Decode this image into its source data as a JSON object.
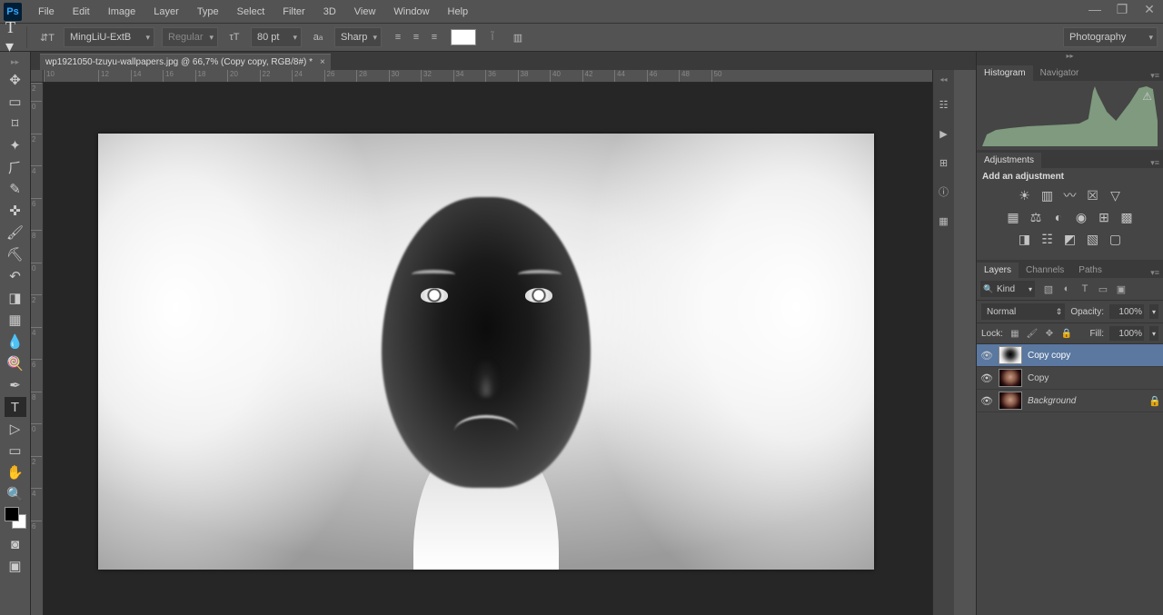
{
  "menu": {
    "items": [
      "File",
      "Edit",
      "Image",
      "Layer",
      "Type",
      "Select",
      "Filter",
      "3D",
      "View",
      "Window",
      "Help"
    ]
  },
  "options": {
    "font": "MingLiU-ExtB",
    "fontStyle": "Regular",
    "size": "80 pt",
    "antialias": "Sharp"
  },
  "workspace": "Photography",
  "document": {
    "tab": "wp1921050-tzuyu-wallpapers.jpg @ 66,7% (Copy copy, RGB/8#) *"
  },
  "ruler_h": [
    "10",
    "12",
    "14",
    "16",
    "18",
    "20",
    "22",
    "24",
    "26",
    "28",
    "30",
    "32",
    "34",
    "36",
    "38",
    "40",
    "42",
    "44",
    "46",
    "48",
    "50"
  ],
  "ruler_v": [
    "2",
    "0",
    "2",
    "4",
    "6",
    "8",
    "0",
    "2",
    "4",
    "6",
    "8",
    "0",
    "2",
    "4",
    "6"
  ],
  "panels": {
    "histogram_tab": "Histogram",
    "navigator_tab": "Navigator",
    "adjustments_tab": "Adjustments",
    "add_adjustment": "Add an adjustment",
    "layers_tab": "Layers",
    "channels_tab": "Channels",
    "paths_tab": "Paths",
    "filter_kind": "Kind",
    "blend_mode": "Normal",
    "opacity_label": "Opacity:",
    "opacity_value": "100%",
    "fill_label": "Fill:",
    "fill_value": "100%",
    "lock_label": "Lock:",
    "layers": [
      {
        "name": "Copy copy",
        "visible": true,
        "selected": true,
        "thumbClass": "img-neg",
        "locked": false,
        "italic": false
      },
      {
        "name": "Copy",
        "visible": true,
        "selected": false,
        "thumbClass": "img-pos",
        "locked": false,
        "italic": false
      },
      {
        "name": "Background",
        "visible": true,
        "selected": false,
        "thumbClass": "img-pos",
        "locked": true,
        "italic": true
      }
    ]
  }
}
